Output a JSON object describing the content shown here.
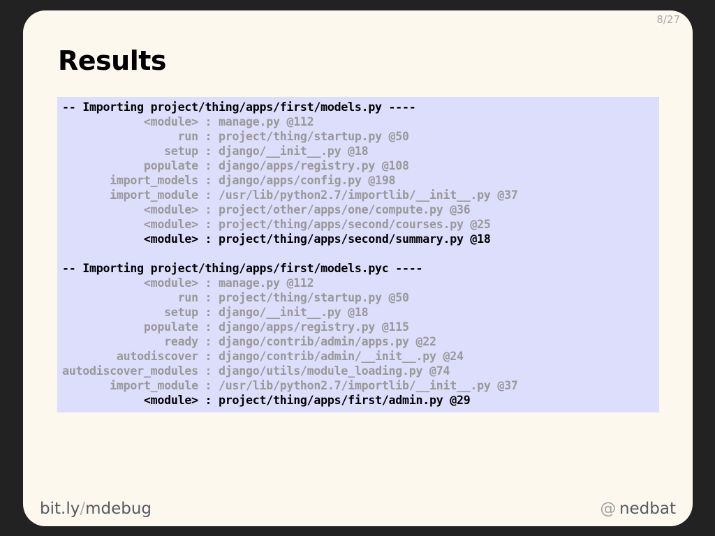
{
  "slide": {
    "page_number": "8/27",
    "title": "Results"
  },
  "code_block": {
    "lines": [
      {
        "type": "header",
        "text": "-- Importing project/thing/apps/first/models.py ----"
      },
      {
        "type": "frame",
        "func": "<module>",
        "loc": "manage.py @112",
        "highlight": false
      },
      {
        "type": "frame",
        "func": "run",
        "loc": "project/thing/startup.py @50",
        "highlight": false
      },
      {
        "type": "frame",
        "func": "setup",
        "loc": "django/__init__.py @18",
        "highlight": false
      },
      {
        "type": "frame",
        "func": "populate",
        "loc": "django/apps/registry.py @108",
        "highlight": false
      },
      {
        "type": "frame",
        "func": "import_models",
        "loc": "django/apps/config.py @198",
        "highlight": false
      },
      {
        "type": "frame",
        "func": "import_module",
        "loc": "/usr/lib/python2.7/importlib/__init__.py @37",
        "highlight": false
      },
      {
        "type": "frame",
        "func": "<module>",
        "loc": "project/other/apps/one/compute.py @36",
        "highlight": false
      },
      {
        "type": "frame",
        "func": "<module>",
        "loc": "project/thing/apps/second/courses.py @25",
        "highlight": false
      },
      {
        "type": "frame",
        "func": "<module>",
        "loc": "project/thing/apps/second/summary.py @18",
        "highlight": true
      },
      {
        "type": "blank",
        "text": ""
      },
      {
        "type": "header",
        "text": "-- Importing project/thing/apps/first/models.pyc ----"
      },
      {
        "type": "frame",
        "func": "<module>",
        "loc": "manage.py @112",
        "highlight": false
      },
      {
        "type": "frame",
        "func": "run",
        "loc": "project/thing/startup.py @50",
        "highlight": false
      },
      {
        "type": "frame",
        "func": "setup",
        "loc": "django/__init__.py @18",
        "highlight": false
      },
      {
        "type": "frame",
        "func": "populate",
        "loc": "django/apps/registry.py @115",
        "highlight": false
      },
      {
        "type": "frame",
        "func": "ready",
        "loc": "django/contrib/admin/apps.py @22",
        "highlight": false
      },
      {
        "type": "frame",
        "func": "autodiscover",
        "loc": "django/contrib/admin/__init__.py @24",
        "highlight": false
      },
      {
        "type": "frame",
        "func": "autodiscover_modules",
        "loc": "django/utils/module_loading.py @74",
        "highlight": false
      },
      {
        "type": "frame",
        "func": "import_module",
        "loc": "/usr/lib/python2.7/importlib/__init__.py @37",
        "highlight": false
      },
      {
        "type": "frame",
        "func": "<module>",
        "loc": "project/thing/apps/first/admin.py @29",
        "highlight": true
      }
    ]
  },
  "footer": {
    "left_prefix": "bit.ly",
    "left_separator": "/",
    "left_suffix": "mdebug",
    "right_at": "@",
    "right_handle": "nedbat"
  }
}
